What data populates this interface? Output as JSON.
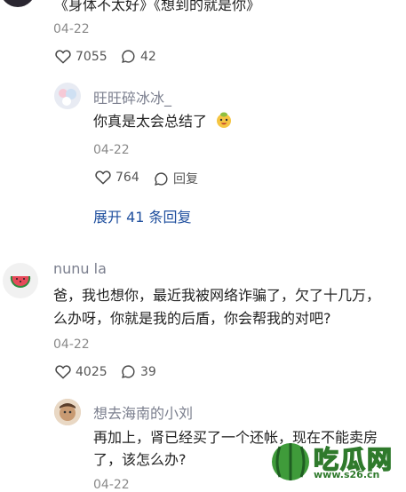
{
  "comment1": {
    "text_tail": "《身体不太好》《想到的就是你》",
    "date": "04-22",
    "likes": "7055",
    "replies": "42"
  },
  "reply1": {
    "username": "旺旺碎冰冰_",
    "text": "你真是太会总结了",
    "date": "04-22",
    "likes": "764",
    "reply_label": "回复",
    "expand_label": "展开 41 条回复"
  },
  "comment2": {
    "username": "nunu la",
    "line1": "爸，我也想你，最近我被网络诈骗了，欠了十几万，",
    "line2": "么办呀，你就是我的后盾，你会帮我的对吧?",
    "date": "04-22",
    "likes": "4025",
    "replies": "39"
  },
  "reply2": {
    "username": "想去海南的小刘",
    "line1": "再加上，肾已经买了一个还帐，现在不能卖房",
    "line2": "了，该怎么办?",
    "date": "04-22"
  },
  "watermark": {
    "brand": "吃瓜网",
    "url": "www.s26.cn"
  },
  "colors": {
    "link": "#1f4f9e",
    "meta": "#8a8a8a",
    "username": "#7b7f8e"
  }
}
